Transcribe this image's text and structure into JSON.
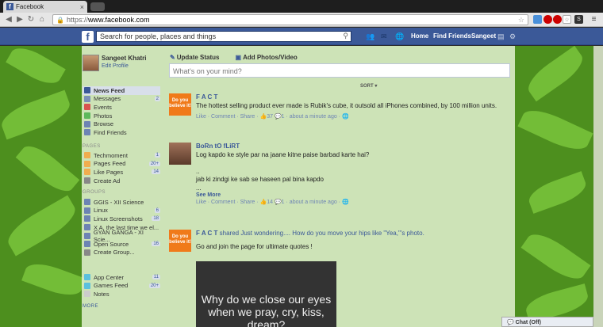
{
  "browser": {
    "tab_title": "Facebook",
    "url_scheme": "https://",
    "url_domain": "www.facebook.com"
  },
  "fb": {
    "search_placeholder": "Search for people, places and things",
    "nav": [
      "Home",
      "Find Friends",
      "Sangeet"
    ]
  },
  "profile": {
    "name": "Sangeet Khatri",
    "edit": "Edit Profile"
  },
  "menu_main": [
    {
      "label": "News Feed",
      "active": true,
      "color": "#3b5998"
    },
    {
      "label": "Messages",
      "badge": "2",
      "color": "#7a8fb8"
    },
    {
      "label": "Events",
      "color": "#d9534f"
    },
    {
      "label": "Photos",
      "color": "#5cb85c"
    },
    {
      "label": "Browse",
      "color": "#6d84b4"
    },
    {
      "label": "Find Friends",
      "color": "#6d84b4"
    }
  ],
  "sections": {
    "pages": "PAGES",
    "groups": "GROUPS",
    "more": "MORE"
  },
  "menu_pages": [
    {
      "label": "Techmoment",
      "badge": "1",
      "color": "#f0ad4e"
    },
    {
      "label": "Pages Feed",
      "badge": "20+",
      "color": "#f0ad4e"
    },
    {
      "label": "Like Pages",
      "badge": "14",
      "color": "#f0ad4e"
    },
    {
      "label": "Create Ad",
      "color": "#888"
    }
  ],
  "menu_groups": [
    {
      "label": "GGIS - XII Science",
      "color": "#6d84b4"
    },
    {
      "label": "Linux",
      "badge": "6",
      "color": "#6d84b4"
    },
    {
      "label": "Linux Screenshots",
      "badge": "18",
      "color": "#6d84b4"
    },
    {
      "label": "X A, the last time we el...",
      "color": "#6d84b4"
    },
    {
      "label": "GYAN GANGA - XI Scie...",
      "color": "#6d84b4"
    },
    {
      "label": "Open Source",
      "badge": "16",
      "color": "#6d84b4"
    },
    {
      "label": "Create Group...",
      "color": "#888"
    }
  ],
  "menu_apps": [
    {
      "label": "App Center",
      "badge": "11",
      "color": "#5bc0de"
    },
    {
      "label": "Games Feed",
      "badge": "20+",
      "color": "#5bc0de"
    },
    {
      "label": "Notes",
      "color": "#ccc"
    }
  ],
  "composer": {
    "update_status": "Update Status",
    "add_photos": "Add Photos/Video",
    "placeholder": "What's on your mind?",
    "sort": "SORT ▾"
  },
  "posts": [
    {
      "author": "F A C T",
      "avatar_text": "Do you believe it!",
      "text": "The hottest selling product ever made is Rubik's cube, it outsold all iPhones combined, by 100 million units.",
      "actions": "Like · Comment · Share · 👍37 💬1 · about a minute ago · 🌐"
    },
    {
      "author": "BoRn tO fLiRT",
      "line1": "Log kapdo ke style par na jaane kitne paise barbad karte hai?",
      "line2": "..",
      "line3": "jab ki zindgi ke sab se haseen pal bina kapdo",
      "line4": "...",
      "see_more": "See More",
      "actions": "Like · Comment · Share · 👍14 💬1 · about a minute ago · 🌐"
    },
    {
      "author": "F A C T",
      "author_extra": " shared Just wondering.... How do you move your hips like \"Yea,\"'s photo.",
      "avatar_text": "Do you believe it!",
      "text": "Go and join the page for ultimate quotes !",
      "quote": "Why do we close our eyes when we pray, cry, kiss, dream?"
    }
  ],
  "chat": "Chat (Off)"
}
